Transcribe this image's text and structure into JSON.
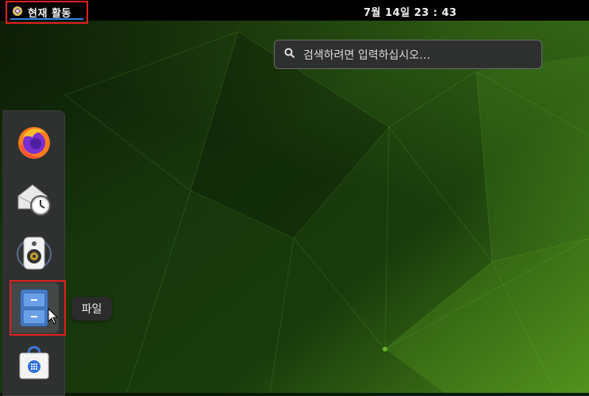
{
  "topbar": {
    "activities_label": "현재 활동",
    "clock": "7월 14일  23 : 43"
  },
  "search": {
    "placeholder": "검색하려면 입력하십시오…"
  },
  "dash": {
    "items": [
      {
        "name": "Firefox",
        "icon": "firefox-icon"
      },
      {
        "name": "Evolution",
        "icon": "mail-clock-icon"
      },
      {
        "name": "Rhythmbox",
        "icon": "speaker-icon"
      },
      {
        "name": "파일",
        "icon": "file-cabinet-icon"
      },
      {
        "name": "Software",
        "icon": "software-bag-icon"
      }
    ],
    "tooltip": "파일"
  },
  "colors": {
    "highlight": "#e0201b",
    "accent": "#3584e4"
  }
}
